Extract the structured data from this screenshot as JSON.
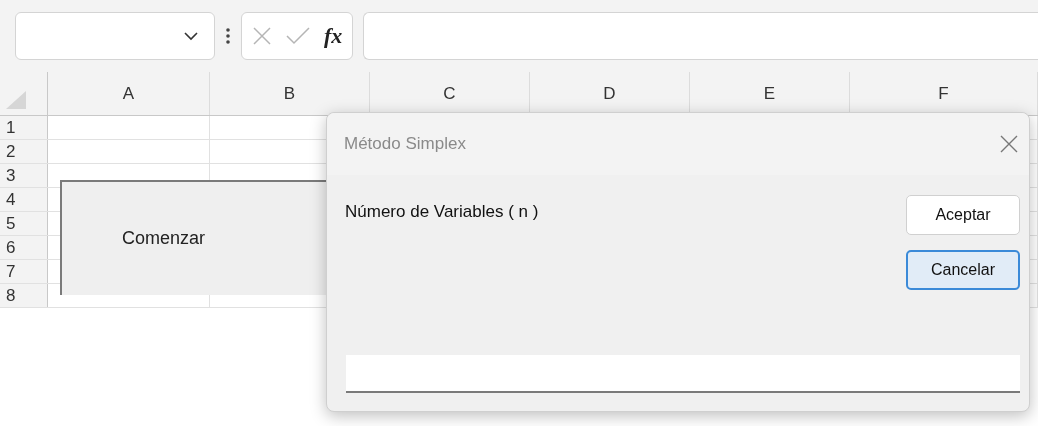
{
  "formula_bar": {
    "function_label": "fx"
  },
  "sheet": {
    "columns": [
      "A",
      "B",
      "C",
      "D",
      "E",
      "F"
    ],
    "rows": [
      "1",
      "2",
      "3",
      "4",
      "5",
      "6",
      "7",
      "8"
    ],
    "shape_button": {
      "label": "Comenzar"
    }
  },
  "dialog": {
    "title": "Método Simplex",
    "prompt": "Número de Variables ( n )",
    "buttons": [
      {
        "label": "Aceptar",
        "focused": false
      },
      {
        "label": "Cancelar",
        "focused": true
      }
    ]
  }
}
